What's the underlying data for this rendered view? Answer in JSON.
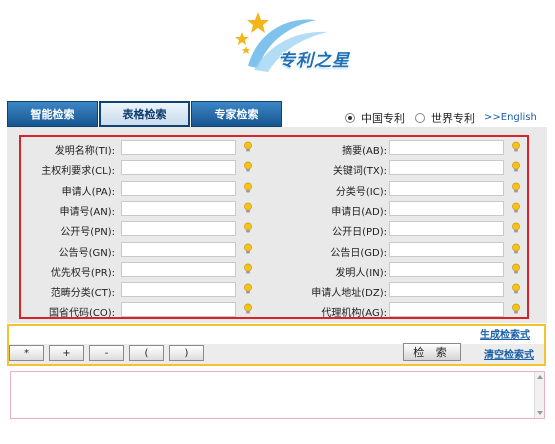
{
  "logo": {
    "text": "专利之星"
  },
  "tabs": [
    {
      "label": "智能检索",
      "active": false
    },
    {
      "label": "表格检索",
      "active": true
    },
    {
      "label": "专家检索",
      "active": false
    }
  ],
  "database": {
    "options": [
      {
        "label": "中国专利",
        "selected": true
      },
      {
        "label": "世界专利",
        "selected": false
      }
    ],
    "english_link": ">>English"
  },
  "fields": [
    {
      "left": "发明名称(TI):",
      "right": "摘要(AB):"
    },
    {
      "left": "主权利要求(CL):",
      "right": "关键词(TX):"
    },
    {
      "left": "申请人(PA):",
      "right": "分类号(IC):"
    },
    {
      "left": "申请号(AN):",
      "right": "申请日(AD):"
    },
    {
      "left": "公开号(PN):",
      "right": "公开日(PD):"
    },
    {
      "left": "公告号(GN):",
      "right": "公告日(GD):"
    },
    {
      "left": "优先权号(PR):",
      "right": "发明人(IN):"
    },
    {
      "left": "范畴分类(CT):",
      "right": "申请人地址(DZ):"
    },
    {
      "left": "国省代码(CO):",
      "right": "代理机构(AG):"
    }
  ],
  "operators": [
    "*",
    "+",
    "-",
    "(",
    ")"
  ],
  "search_label": "检 索",
  "generate_link": "生成检索式",
  "clear_link": "清空检索式",
  "colors": {
    "tab_blue": "#16568f",
    "form_border": "#d8232a",
    "op_border": "#f2c230",
    "link": "#1b5fa5"
  }
}
